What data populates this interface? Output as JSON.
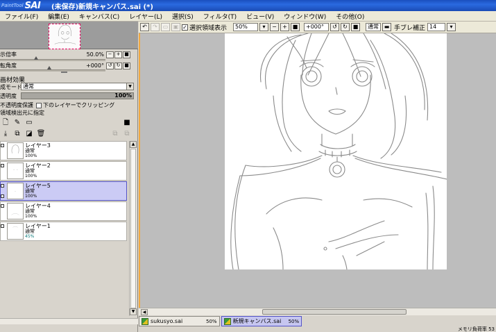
{
  "window": {
    "logo_small": "PaintTool",
    "logo_big": "SAI",
    "title": "(未保存)新規キャンバス.sai (*)"
  },
  "menu": [
    {
      "label": "ファイル(F)"
    },
    {
      "label": "編集(E)"
    },
    {
      "label": "キャンバス(C)"
    },
    {
      "label": "レイヤー(L)"
    },
    {
      "label": "選択(S)"
    },
    {
      "label": "フィルタ(T)"
    },
    {
      "label": "ビュー(V)"
    },
    {
      "label": "ウィンドウ(W)"
    },
    {
      "label": "その他(O)"
    }
  ],
  "navigator": {
    "zoom_label": "示倍率",
    "zoom_value": "50.0%",
    "angle_label": "転角度",
    "angle_value": "+000°",
    "zoom_buttons": [
      "−",
      "+",
      "■"
    ],
    "angle_buttons": [
      "↺",
      "↻",
      "■"
    ]
  },
  "layer_props": {
    "section_title": "画材効果",
    "mode_label": "成モード",
    "mode_value": "通常",
    "opacity_label": "透明度",
    "opacity_value": "100%",
    "protect_label": "不透明度保護",
    "clip_label": "下のレイヤーでクリッピング",
    "source_label": "領域検出元に指定"
  },
  "layers": [
    {
      "name": "レイヤー3",
      "mode": "通常",
      "opacity": "100%",
      "selected": false
    },
    {
      "name": "レイヤー2",
      "mode": "通常",
      "opacity": "100%",
      "selected": false
    },
    {
      "name": "レイヤー5",
      "mode": "通常",
      "opacity": "100%",
      "selected": true
    },
    {
      "name": "レイヤー4",
      "mode": "通常",
      "opacity": "100%",
      "selected": false
    },
    {
      "name": "レイヤー1",
      "mode": "通常",
      "opacity": "45%",
      "selected": false
    }
  ],
  "canvas_toolbar": {
    "selection_label": "選択領域表示",
    "zoom_value": "50%",
    "angle_value": "+000°",
    "mode_value": "通常",
    "stabilizer_label": "手ブレ補正",
    "stabilizer_value": "14"
  },
  "tabs": [
    {
      "name": "sukusyo.sai",
      "zoom": "50%",
      "active": false
    },
    {
      "name": "新規キャンバス.sai",
      "zoom": "50%",
      "active": true
    }
  ],
  "status": {
    "text": "メモリ負荷率 53"
  },
  "colors": {
    "titlebar": "#2a6ae0",
    "selected_layer": "#cbcbf5",
    "canvas_border": "#f0a840",
    "sketch_stroke": "#8a8a8a"
  }
}
